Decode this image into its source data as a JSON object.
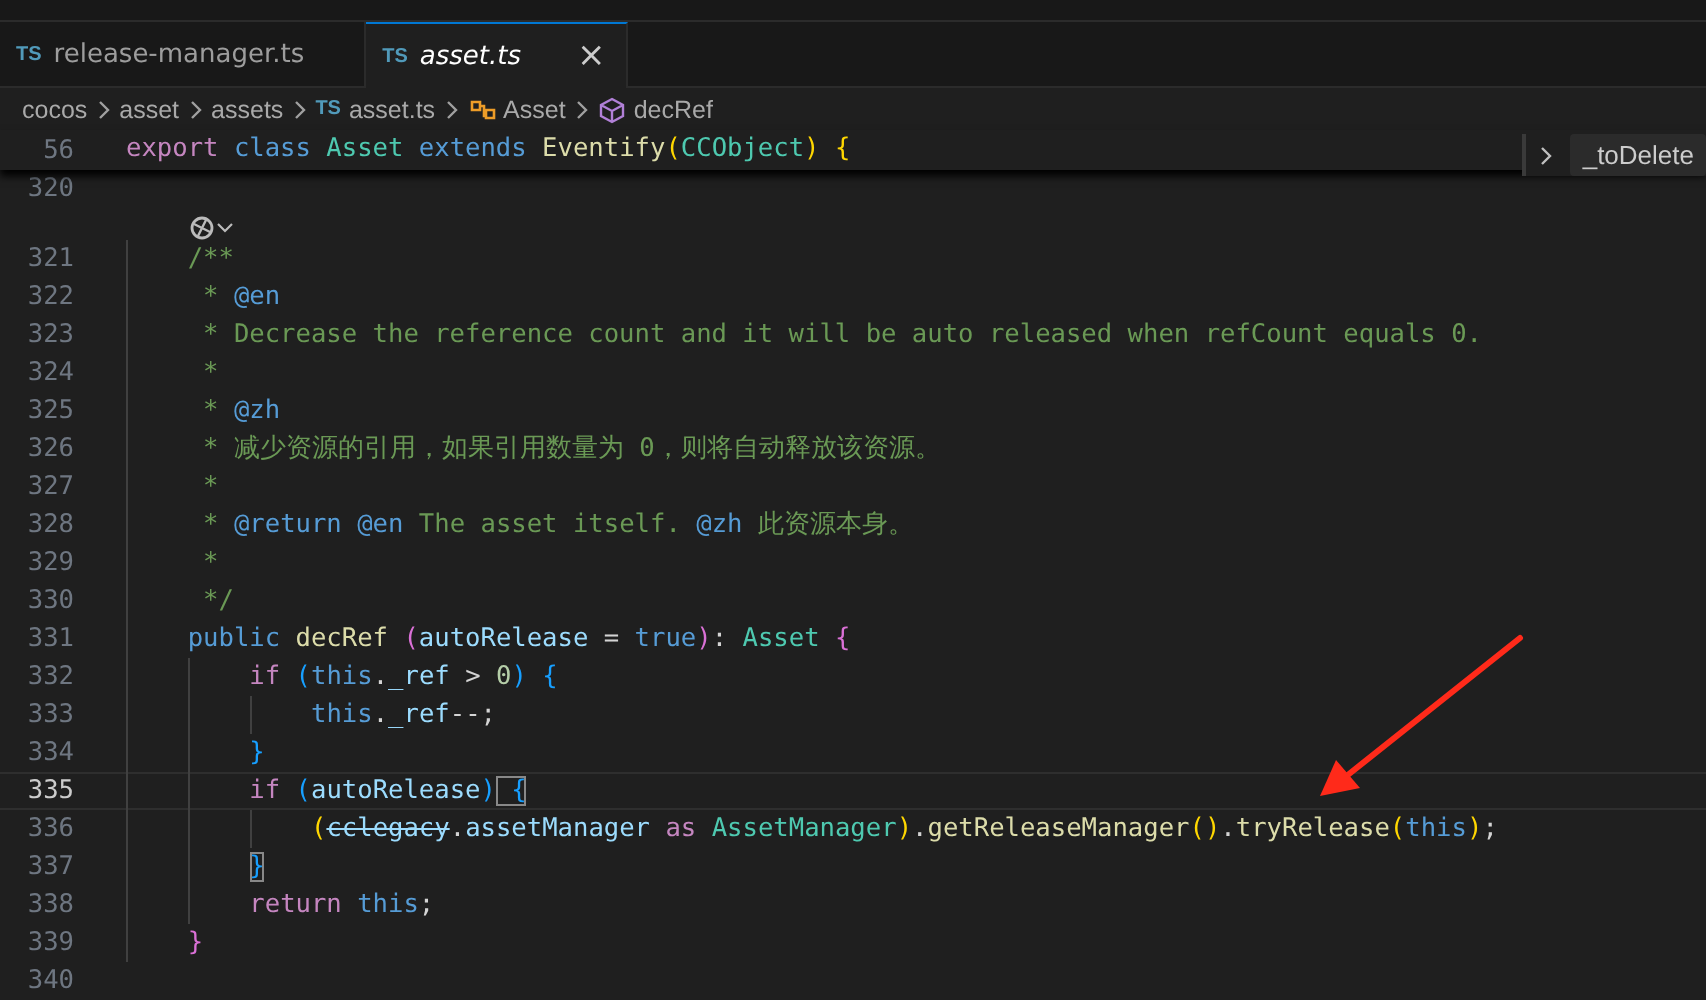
{
  "tabs": [
    {
      "badge": "TS",
      "label": "release-manager.ts",
      "selected": false,
      "preview": false
    },
    {
      "badge": "TS",
      "label": "asset.ts",
      "selected": true,
      "preview": true,
      "close": "×"
    }
  ],
  "breadcrumbs": [
    {
      "kind": "folder",
      "label": "cocos"
    },
    {
      "kind": "folder",
      "label": "asset"
    },
    {
      "kind": "folder",
      "label": "assets"
    },
    {
      "kind": "file",
      "badge": "TS",
      "label": "asset.ts"
    },
    {
      "kind": "class",
      "label": "Asset"
    },
    {
      "kind": "method",
      "label": "decRef"
    }
  ],
  "sticky_line": {
    "number": "56",
    "tokens": [
      {
        "text": "export",
        "kind": "kw"
      },
      {
        "text": " class",
        "kind": "storage"
      },
      {
        "text": " Asset",
        "kind": "type"
      },
      {
        "text": " extends",
        "kind": "storage"
      },
      {
        "text": " Eventify",
        "kind": "fn"
      },
      {
        "text": "(",
        "kind": "br1"
      },
      {
        "text": "CCObject",
        "kind": "type"
      },
      {
        "text": ")",
        "kind": "br1"
      },
      {
        "text": " {",
        "kind": "br1"
      }
    ]
  },
  "sticky_outline": {
    "label": "_toDelete"
  },
  "lines": [
    {
      "kind": "code",
      "number": "320",
      "current": false
    },
    {
      "kind": "lens"
    },
    {
      "kind": "code",
      "number": "321",
      "current": false,
      "tokens": [
        {
          "text": "    /**",
          "kind": "comment"
        }
      ]
    },
    {
      "kind": "code",
      "number": "322",
      "current": false,
      "tokens": [
        {
          "text": "     *",
          "kind": "comment"
        },
        {
          "text": " @en",
          "kind": "doctag"
        }
      ]
    },
    {
      "kind": "code",
      "number": "323",
      "current": false,
      "tokens": [
        {
          "text": "     * Decrease the reference count and it will be auto released when refCount equals 0.",
          "kind": "comment"
        }
      ]
    },
    {
      "kind": "code",
      "number": "324",
      "current": false,
      "tokens": [
        {
          "text": "     *",
          "kind": "comment"
        }
      ]
    },
    {
      "kind": "code",
      "number": "325",
      "current": false,
      "tokens": [
        {
          "text": "     *",
          "kind": "comment"
        },
        {
          "text": " @zh",
          "kind": "doctag"
        }
      ]
    },
    {
      "kind": "code",
      "number": "326",
      "current": false,
      "tokens": [
        {
          "text": "     * 减少资源的引用，如果引用数量为 0，则将自动释放该资源。",
          "kind": "comment"
        }
      ]
    },
    {
      "kind": "code",
      "number": "327",
      "current": false,
      "tokens": [
        {
          "text": "     *",
          "kind": "comment"
        }
      ]
    },
    {
      "kind": "code",
      "number": "328",
      "current": false,
      "tokens": [
        {
          "text": "     *",
          "kind": "comment"
        },
        {
          "text": " @return",
          "kind": "doctag"
        },
        {
          "text": " @en",
          "kind": "doctag"
        },
        {
          "text": " The asset itself.",
          "kind": "comment"
        },
        {
          "text": " @zh",
          "kind": "doctag"
        },
        {
          "text": " 此资源本身。",
          "kind": "comment"
        }
      ]
    },
    {
      "kind": "code",
      "number": "329",
      "current": false,
      "tokens": [
        {
          "text": "     *",
          "kind": "comment"
        }
      ]
    },
    {
      "kind": "code",
      "number": "330",
      "current": false,
      "tokens": [
        {
          "text": "     */",
          "kind": "comment"
        }
      ]
    },
    {
      "kind": "code",
      "number": "331",
      "current": false,
      "tokens": [
        {
          "text": "    public",
          "kind": "storage"
        },
        {
          "text": " decRef",
          "kind": "fn"
        },
        {
          "text": " (",
          "kind": "br2"
        },
        {
          "text": "autoRelease",
          "kind": "var"
        },
        {
          "text": " =",
          "kind": "plain"
        },
        {
          "text": " true",
          "kind": "storage"
        },
        {
          "text": ")",
          "kind": "br2"
        },
        {
          "text": ":",
          "kind": "plain"
        },
        {
          "text": " Asset",
          "kind": "type"
        },
        {
          "text": " {",
          "kind": "br2"
        }
      ]
    },
    {
      "kind": "code",
      "number": "332",
      "current": false,
      "tokens": [
        {
          "text": "        if",
          "kind": "kw"
        },
        {
          "text": " (",
          "kind": "br3"
        },
        {
          "text": "this",
          "kind": "storage"
        },
        {
          "text": ".",
          "kind": "plain"
        },
        {
          "text": "_ref",
          "kind": "var"
        },
        {
          "text": " >",
          "kind": "plain"
        },
        {
          "text": " 0",
          "kind": "num"
        },
        {
          "text": ")",
          "kind": "br3"
        },
        {
          "text": " {",
          "kind": "br3"
        }
      ]
    },
    {
      "kind": "code",
      "number": "333",
      "current": false,
      "tokens": [
        {
          "text": "            this",
          "kind": "storage"
        },
        {
          "text": ".",
          "kind": "plain"
        },
        {
          "text": "_ref",
          "kind": "var"
        },
        {
          "text": "--;",
          "kind": "plain"
        }
      ]
    },
    {
      "kind": "code",
      "number": "334",
      "current": false,
      "tokens": [
        {
          "text": "        }",
          "kind": "br3"
        }
      ]
    },
    {
      "kind": "code",
      "number": "335",
      "current": true,
      "tokens": [
        {
          "text": "        if",
          "kind": "kw"
        },
        {
          "text": " (",
          "kind": "br3"
        },
        {
          "text": "autoRelease",
          "kind": "var"
        },
        {
          "text": ")",
          "kind": "br3"
        },
        {
          "text": " {",
          "kind": "br3match"
        }
      ]
    },
    {
      "kind": "code",
      "number": "336",
      "current": false,
      "tokens": [
        {
          "text": "            (",
          "kind": "br1"
        },
        {
          "text": "cclegacy",
          "kind": "deprecated"
        },
        {
          "text": ".",
          "kind": "plain"
        },
        {
          "text": "assetManager",
          "kind": "var"
        },
        {
          "text": " as",
          "kind": "kw"
        },
        {
          "text": " AssetManager",
          "kind": "type"
        },
        {
          "text": ")",
          "kind": "br1"
        },
        {
          "text": ".",
          "kind": "plain"
        },
        {
          "text": "getReleaseManager",
          "kind": "fn"
        },
        {
          "text": "()",
          "kind": "br1"
        },
        {
          "text": ".",
          "kind": "plain"
        },
        {
          "text": "tryRelease",
          "kind": "fn"
        },
        {
          "text": "(",
          "kind": "br1"
        },
        {
          "text": "this",
          "kind": "storage"
        },
        {
          "text": ")",
          "kind": "br1"
        },
        {
          "text": ";",
          "kind": "plain"
        }
      ]
    },
    {
      "kind": "code",
      "number": "337",
      "current": false,
      "tokens": [
        {
          "text": "        }",
          "kind": "br3match"
        }
      ]
    },
    {
      "kind": "code",
      "number": "338",
      "current": false,
      "tokens": [
        {
          "text": "        return",
          "kind": "kw"
        },
        {
          "text": " this",
          "kind": "storage"
        },
        {
          "text": ";",
          "kind": "plain"
        }
      ]
    },
    {
      "kind": "code",
      "number": "339",
      "current": false,
      "tokens": [
        {
          "text": "    }",
          "kind": "br2"
        }
      ]
    },
    {
      "kind": "code",
      "number": "340",
      "current": false
    }
  ]
}
